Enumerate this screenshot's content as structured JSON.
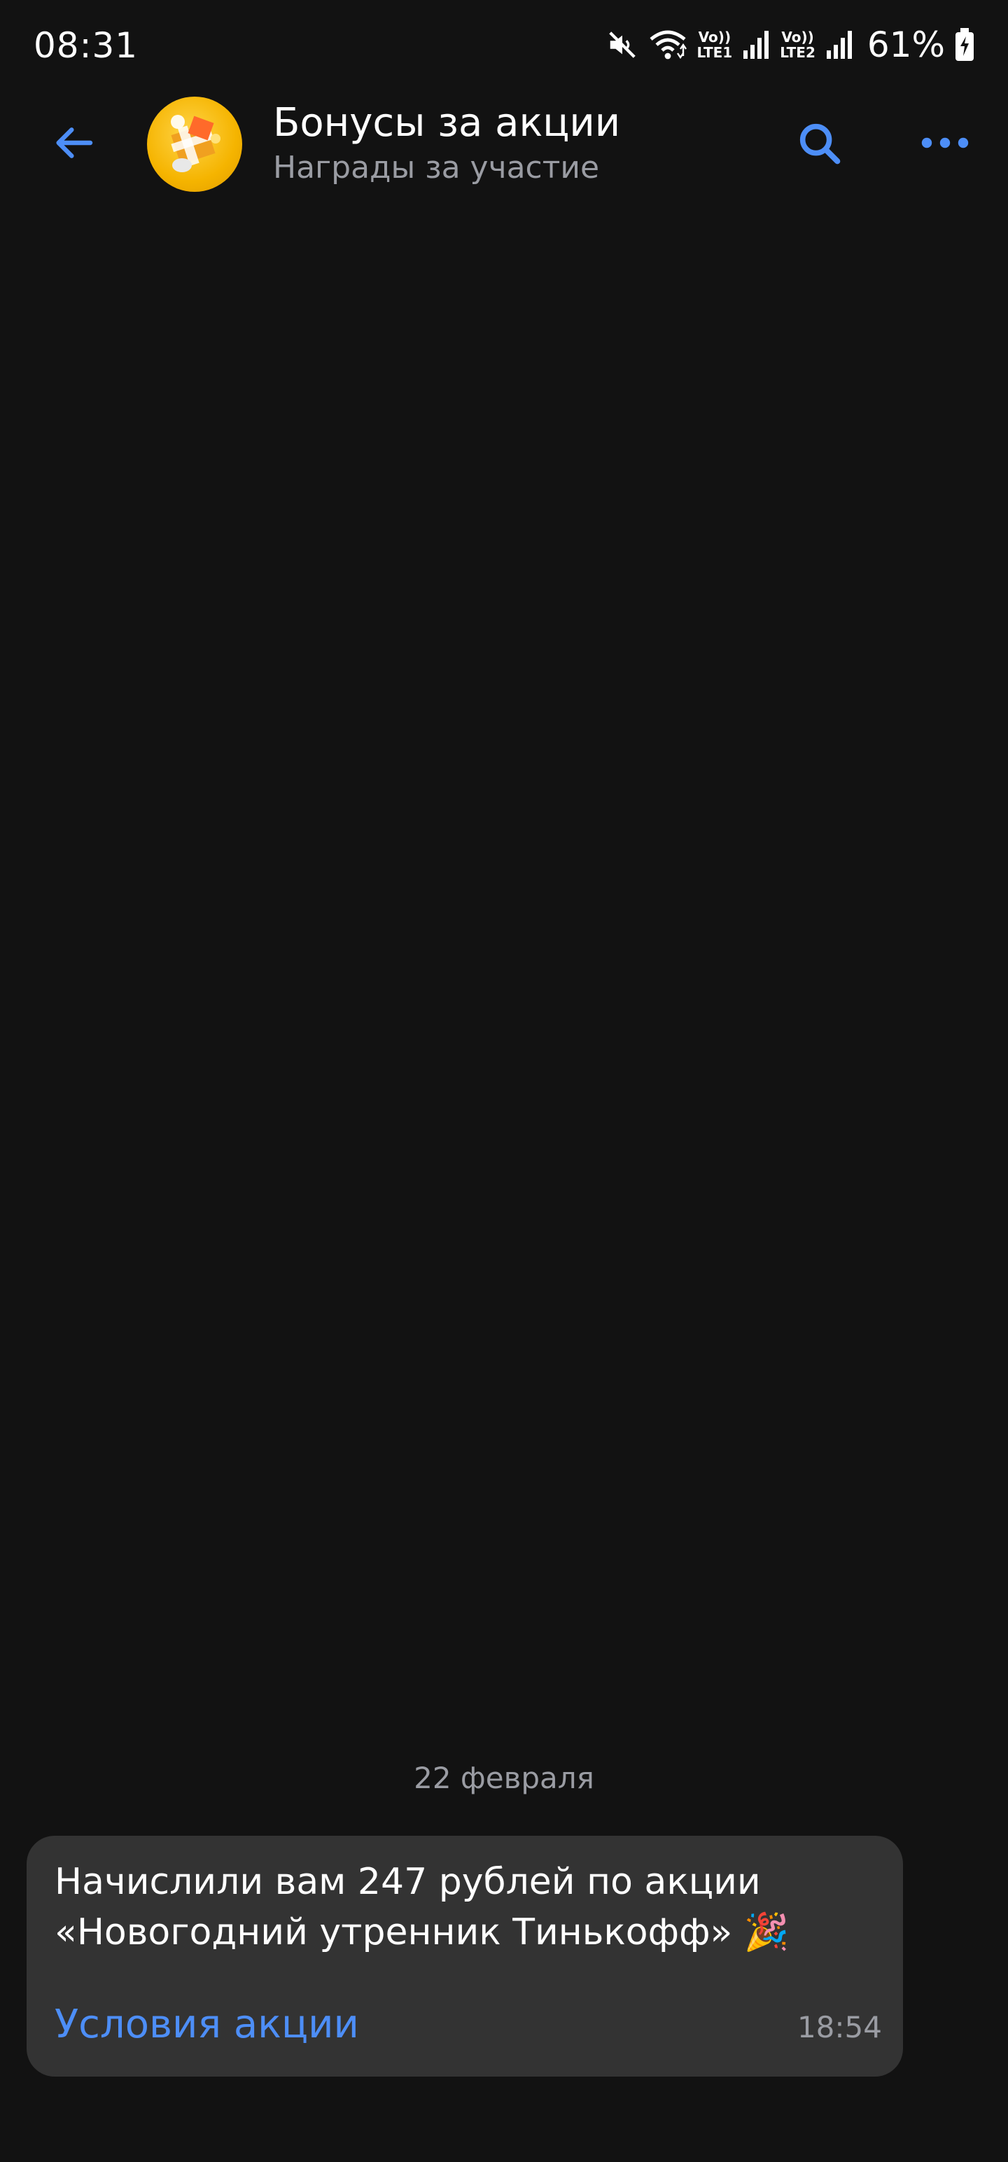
{
  "status_bar": {
    "time": "08:31",
    "sim1_label_top": "Vo))",
    "sim1_label_bottom": "LTE1",
    "sim2_label_top": "Vo))",
    "sim2_label_bottom": "LTE2",
    "battery": "61%",
    "icons": [
      "mute-icon",
      "wifi-icon",
      "signal-icon",
      "battery-icon"
    ]
  },
  "header": {
    "title": "Бонусы за акции",
    "subtitle": "Награды за участие",
    "icons": [
      "arrow-left-icon",
      "search-icon",
      "more-icon"
    ],
    "accent_color": "#4d8ef7"
  },
  "messages": {
    "date": "22 февраля",
    "items": [
      {
        "text": "Начислили вам 247 рублей по акции «Новогодний утренник Тинькофф» 🎉",
        "link": "Условия акции",
        "time": "18:54"
      }
    ]
  },
  "colors": {
    "background": "#121212",
    "bubble": "#333333",
    "secondary_text": "#9a9ca3",
    "link": "#4d8ef7"
  }
}
